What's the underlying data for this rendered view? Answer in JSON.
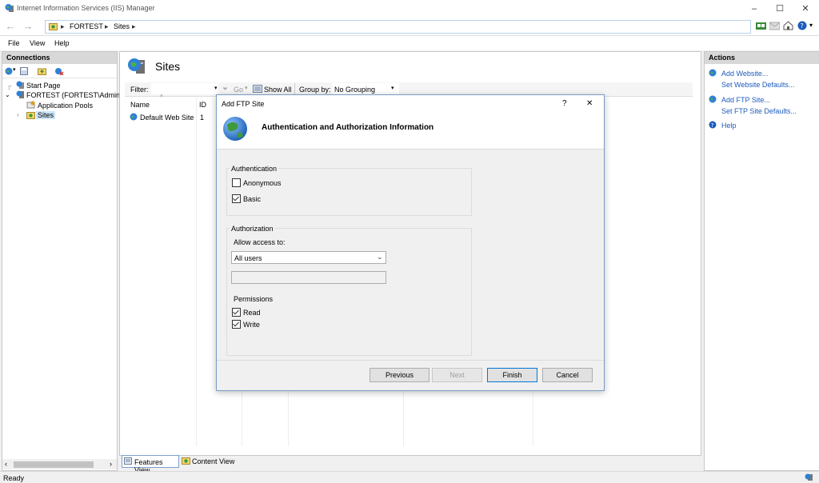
{
  "window": {
    "title": "Internet Information Services (IIS) Manager",
    "minimize": "–",
    "maximize": "☐",
    "close": "✕"
  },
  "address": {
    "segments": [
      "FORTEST",
      "Sites"
    ],
    "separator": "▸"
  },
  "menu": [
    "File",
    "View",
    "Help"
  ],
  "connections": {
    "title": "Connections",
    "tree": [
      "Start Page",
      "FORTEST (FORTEST\\Administ",
      "Application Pools",
      "Sites"
    ]
  },
  "content": {
    "heading": "Sites",
    "filter_label": "Filter:",
    "go_label": "Go",
    "show_all_label": "Show All",
    "group_by_label": "Group by:",
    "group_by_value": "No Grouping",
    "columns": [
      "Name",
      "ID"
    ],
    "rows": [
      {
        "name": "Default Web Site",
        "id": "1"
      }
    ],
    "features_view": "Features View",
    "content_view": "Content View"
  },
  "actions": {
    "title": "Actions",
    "items": [
      "Add Website...",
      "Set Website Defaults...",
      "Add FTP Site...",
      "Set FTP Site Defaults...",
      "Help"
    ]
  },
  "dialog": {
    "title": "Add FTP Site",
    "help": "?",
    "close": "✕",
    "heading": "Authentication and Authorization Information",
    "authentication": {
      "label": "Authentication",
      "anonymous": "Anonymous",
      "anonymous_checked": false,
      "basic": "Basic",
      "basic_checked": true
    },
    "authorization": {
      "label": "Authorization",
      "allow_access_label": "Allow access to:",
      "allow_access_value": "All users",
      "text_value": "",
      "permissions_label": "Permissions",
      "read": "Read",
      "read_checked": true,
      "write": "Write",
      "write_checked": true
    },
    "buttons": {
      "previous": "Previous",
      "next": "Next",
      "finish": "Finish",
      "cancel": "Cancel"
    }
  },
  "status": {
    "text": "Ready"
  },
  "colors": {
    "link": "#1e5bbd",
    "panel_header": "#d8d8d8",
    "dialog_border": "#7a9cc6",
    "default_button_border": "#0078d7"
  }
}
